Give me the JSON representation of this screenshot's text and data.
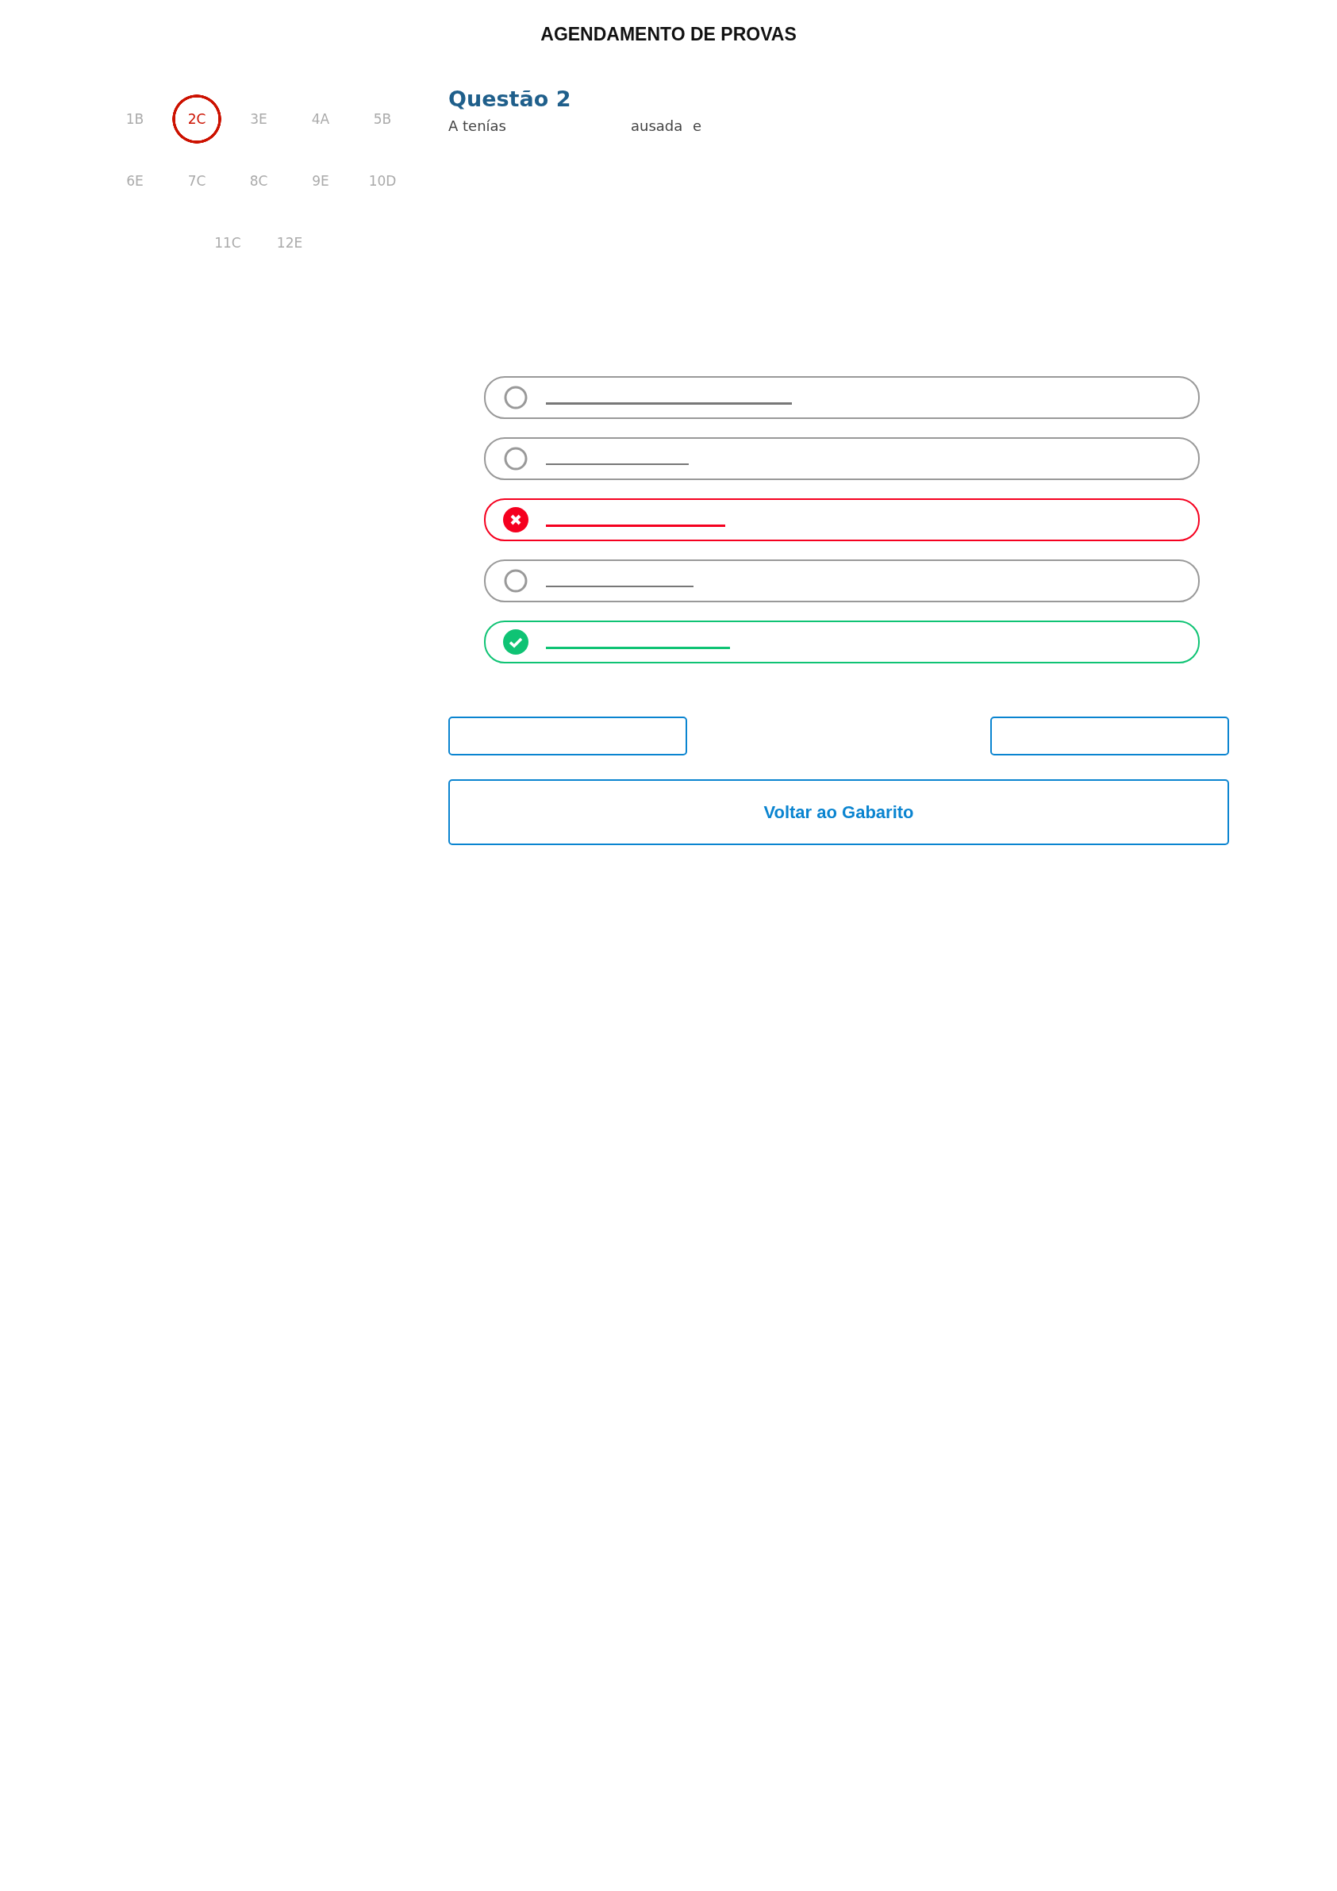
{
  "header": {
    "title": "AGENDAMENTO DE PROVAS"
  },
  "question_nav": [
    {
      "label": "1B",
      "selected": false
    },
    {
      "label": "2C",
      "selected": true
    },
    {
      "label": "3E",
      "selected": false
    },
    {
      "label": "4A",
      "selected": false
    },
    {
      "label": "5B",
      "selected": false
    },
    {
      "label": "6E",
      "selected": false
    },
    {
      "label": "7C",
      "selected": false
    },
    {
      "label": "8C",
      "selected": false
    },
    {
      "label": "9E",
      "selected": false
    },
    {
      "label": "10D",
      "selected": false
    },
    {
      "label": "11C",
      "selected": false
    },
    {
      "label": "12E",
      "selected": false
    }
  ],
  "question": {
    "title": "Questão 2",
    "text_fragments": [
      "A tenías",
      "ausada",
      "e"
    ]
  },
  "options": [
    {
      "kind": "neutral"
    },
    {
      "kind": "neutral"
    },
    {
      "kind": "wrong"
    },
    {
      "kind": "neutral"
    },
    {
      "kind": "correct"
    }
  ],
  "back_button": {
    "label": "Voltar ao Gabarito"
  }
}
